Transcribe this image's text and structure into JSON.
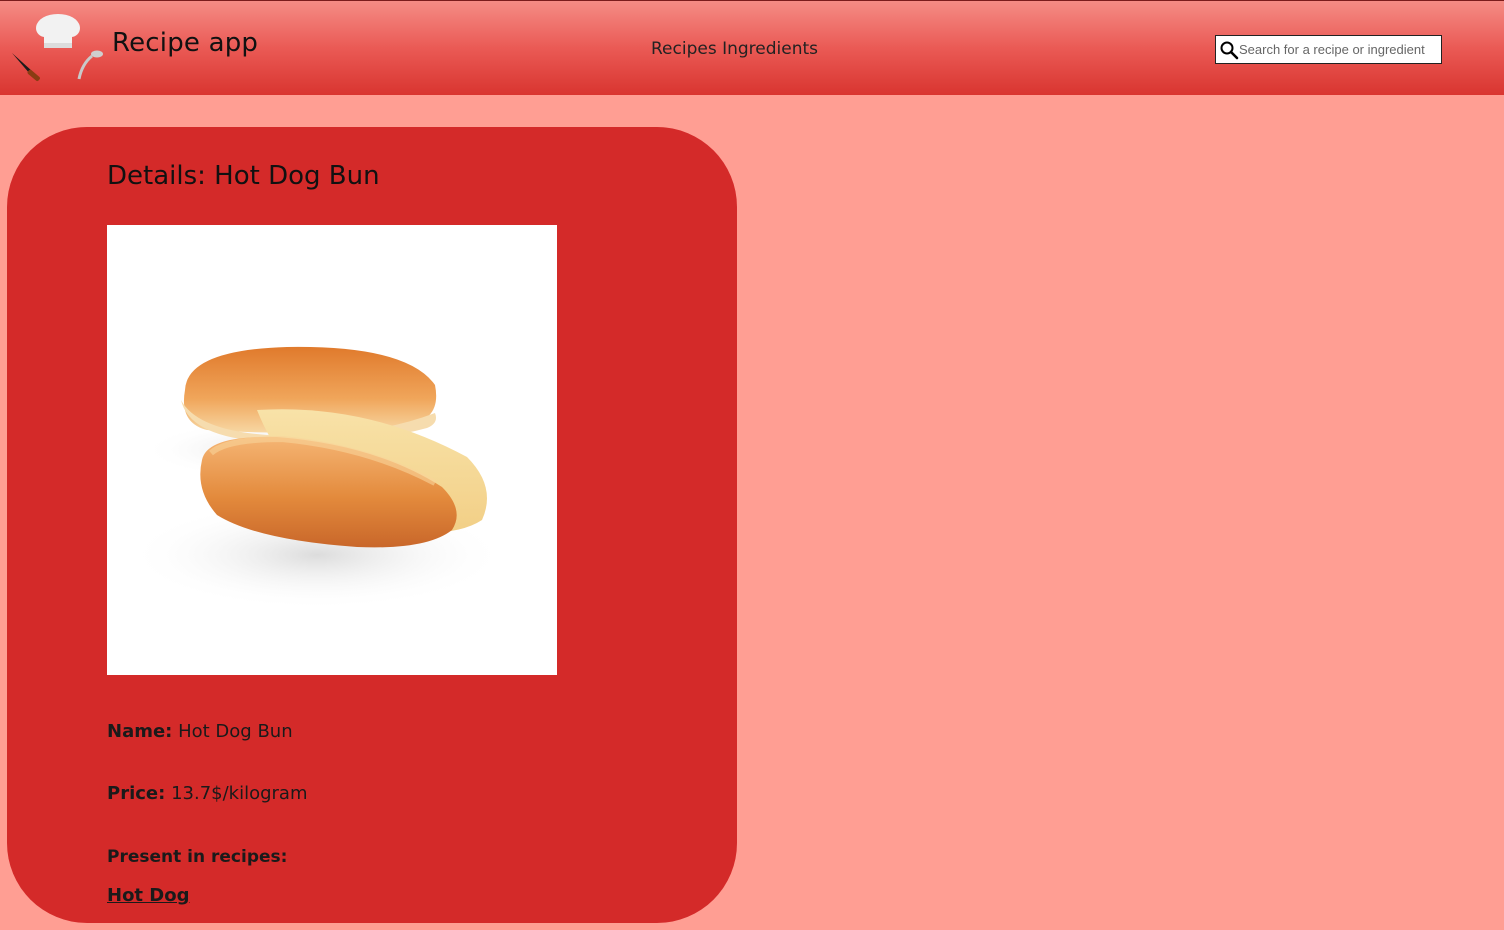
{
  "header": {
    "app_title": "Recipe app",
    "nav": {
      "recipes_label": "Recipes",
      "ingredients_label": "Ingredients"
    },
    "search": {
      "placeholder": "Search for a recipe or ingredient",
      "value": ""
    }
  },
  "details": {
    "title": "Details: Hot Dog Bun",
    "name_label": "Name:",
    "name_value": "Hot Dog Bun",
    "price_label": "Price:",
    "price_value": "13.7$/kilogram",
    "present_label": "Present in recipes:",
    "recipes": [
      "Hot Dog"
    ]
  },
  "colors": {
    "page_background": "#ff9e93",
    "header_gradient_top": "#f58c85",
    "header_gradient_bottom": "#d93530",
    "card_background": "#d42a29"
  },
  "icons": {
    "logo": "chef-hat-knife-ladle-logo",
    "search": "search-icon"
  }
}
